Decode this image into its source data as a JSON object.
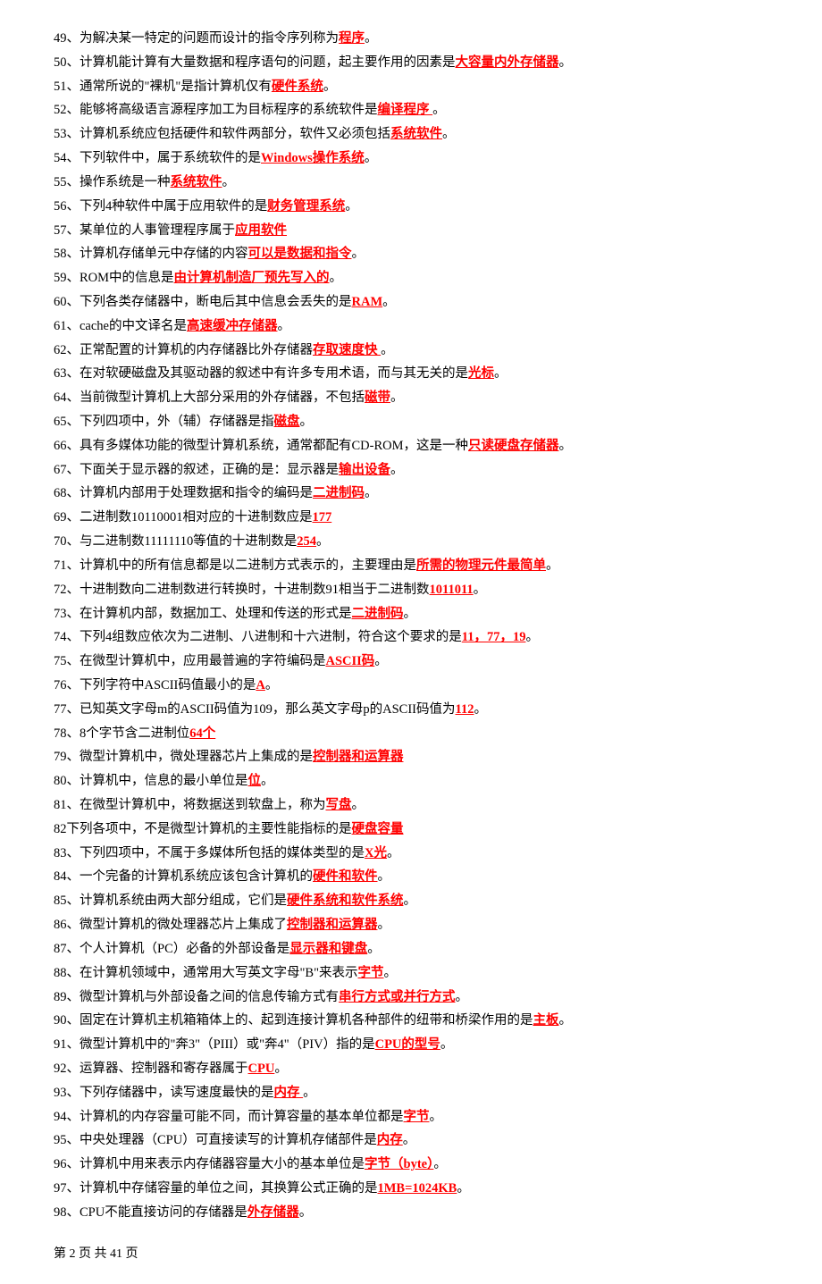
{
  "items": [
    {
      "pre": "49、为解决某一特定的问题而设计的指令序列称为",
      "ans": "程序",
      "post": "。"
    },
    {
      "pre": "50、计算机能计算有大量数据和程序语句的问题，起主要作用的因素是",
      "ans": "大容量内外存储器",
      "post": "。"
    },
    {
      "pre": "51、通常所说的\"裸机\"是指计算机仅有",
      "ans": "硬件系统",
      "post": "。"
    },
    {
      "pre": "52、能够将高级语言源程序加工为目标程序的系统软件是",
      "ans": "编译程序 ",
      "post": "。"
    },
    {
      "pre": "53、计算机系统应包括硬件和软件两部分，软件又必须包括",
      "ans": "系统软件",
      "post": "。"
    },
    {
      "pre": "54、下列软件中，属于系统软件的是",
      "ans": "Windows操作系统",
      "post": "。"
    },
    {
      "pre": "55、操作系统是一种",
      "ans": "系统软件",
      "post": "。"
    },
    {
      "pre": "56、下列4种软件中属于应用软件的是",
      "ans": "财务管理系统",
      "post": "。"
    },
    {
      "pre": "57、某单位的人事管理程序属于",
      "ans": "应用软件",
      "post": ""
    },
    {
      "pre": "58、计算机存储单元中存储的内容",
      "ans": "可以是数据和指令",
      "post": "。"
    },
    {
      "pre": "59、ROM中的信息是",
      "ans": "由计算机制造厂预先写入的",
      "post": "。"
    },
    {
      "pre": "60、下列各类存储器中，断电后其中信息会丢失的是",
      "ans": "RAM",
      "post": "。"
    },
    {
      "pre": "61、cache的中文译名是",
      "ans": "高速缓冲存储器",
      "post": "。"
    },
    {
      "pre": "62、正常配置的计算机的内存储器比外存储器",
      "ans": "存取速度快 ",
      "post": "。"
    },
    {
      "pre": "63、在对软硬磁盘及其驱动器的叙述中有许多专用术语，而与其无关的是",
      "ans": "光标",
      "post": "。"
    },
    {
      "pre": "64、当前微型计算机上大部分采用的外存储器，不包括",
      "ans": "磁带",
      "post": "。"
    },
    {
      "pre": "65、下列四项中，外（辅）存储器是指",
      "ans": "磁盘",
      "post": "。"
    },
    {
      "pre": "66、具有多媒体功能的微型计算机系统，通常都配有CD-ROM，这是一种",
      "ans": "只读硬盘存储器",
      "post": "。"
    },
    {
      "pre": "67、下面关于显示器的叙述，正确的是：显示器是",
      "ans": "输出设备",
      "post": "。"
    },
    {
      "pre": "68、计算机内部用于处理数据和指令的编码是",
      "ans": "二进制码",
      "post": "。"
    },
    {
      "pre": "69、二进制数10110001相对应的十进制数应是",
      "ans": "177",
      "post": ""
    },
    {
      "pre": "70、与二进制数11111110等值的十进制数是",
      "ans": "254",
      "post": "。"
    },
    {
      "pre": "71、计算机中的所有信息都是以二进制方式表示的，主要理由是",
      "ans": "所需的物理元件最简单",
      "post": "。"
    },
    {
      "pre": "72、十进制数向二进制数进行转换时，十进制数91相当于二进制数",
      "ans": "1011011",
      "post": "。"
    },
    {
      "pre": "73、在计算机内部，数据加工、处理和传送的形式是",
      "ans": "二进制码",
      "post": "。"
    },
    {
      "pre": "74、下列4组数应依次为二进制、八进制和十六进制，符合这个要求的是",
      "ans": "11，77，19",
      "post": "。"
    },
    {
      "pre": "75、在微型计算机中，应用最普遍的字符编码是",
      "ans": "ASCII码",
      "post": "。"
    },
    {
      "pre": "76、下列字符中ASCII码值最小的是",
      "ans": "A",
      "post": "。"
    },
    {
      "pre": "77、已知英文字母m的ASCII码值为109，那么英文字母p的ASCII码值为",
      "ans": "112",
      "post": "。"
    },
    {
      "pre": "78、8个字节含二进制位",
      "ans": "64个",
      "post": ""
    },
    {
      "pre": "79、微型计算机中，微处理器芯片上集成的是",
      "ans": "控制器和运算器",
      "post": ""
    },
    {
      "pre": "80、计算机中，信息的最小单位是",
      "ans": "位",
      "post": "。"
    },
    {
      "pre": "81、在微型计算机中，将数据送到软盘上，称为",
      "ans": "写盘",
      "post": "。"
    },
    {
      "pre": "82下列各项中，不是微型计算机的主要性能指标的是",
      "ans": "硬盘容量",
      "post": ""
    },
    {
      "pre": "83、下列四项中，不属于多媒体所包括的媒体类型的是",
      "ans": "X光",
      "post": "。"
    },
    {
      "pre": "84、一个完备的计算机系统应该包含计算机的",
      "ans": "硬件和软件",
      "post": "。"
    },
    {
      "pre": "85、计算机系统由两大部分组成，它们是",
      "ans": "硬件系统和软件系统",
      "post": "。"
    },
    {
      "pre": "86、微型计算机的微处理器芯片上集成了",
      "ans": "控制器和运算器",
      "post": "。"
    },
    {
      "pre": "87、个人计算机（PC）必备的外部设备是",
      "ans": "显示器和键盘",
      "post": "。"
    },
    {
      "pre": "88、在计算机领域中，通常用大写英文字母\"B\"来表示",
      "ans": "字节",
      "post": "。"
    },
    {
      "pre": "89、微型计算机与外部设备之间的信息传输方式有",
      "ans": "串行方式或并行方式",
      "post": "。"
    },
    {
      "pre": "90、固定在计算机主机箱箱体上的、起到连接计算机各种部件的纽带和桥梁作用的是",
      "ans": "主板",
      "post": "。"
    },
    {
      "pre": "91、微型计算机中的\"奔3\"（PIII）或\"奔4\"（PIV）指的是",
      "ans": "CPU的型号",
      "post": "。"
    },
    {
      "pre": "92、运算器、控制器和寄存器属于",
      "ans": "CPU",
      "post": "。"
    },
    {
      "pre": "93、下列存储器中，读写速度最快的是",
      "ans": "内存 ",
      "post": "。"
    },
    {
      "pre": "94、计算机的内存容量可能不同，而计算容量的基本单位都是",
      "ans": "字节",
      "post": "。"
    },
    {
      "pre": "95、中央处理器（CPU）可直接读写的计算机存储部件是",
      "ans": "内存",
      "post": "。"
    },
    {
      "pre": "96、计算机中用来表示内存储器容量大小的基本单位是",
      "ans": "字节（byte）",
      "post": "。"
    },
    {
      "pre": "97、计算机中存储容量的单位之间，其换算公式正确的是",
      "ans": "1MB=1024KB",
      "post": "。"
    },
    {
      "pre": "98、CPU不能直接访问的存储器是",
      "ans": "外存储器",
      "post": "。"
    }
  ],
  "footer": "第 2 页 共 41 页"
}
